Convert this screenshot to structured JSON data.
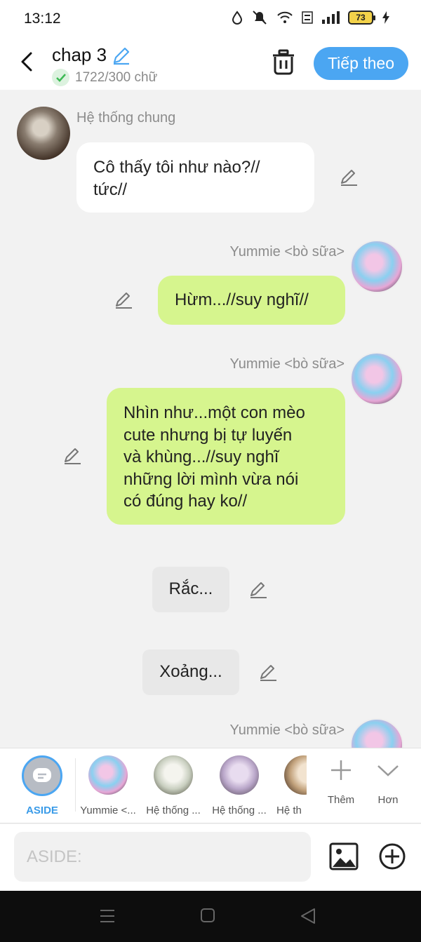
{
  "status": {
    "time": "13:12",
    "battery": "73"
  },
  "header": {
    "title": "chap 3",
    "wordcount": "1722/300 chữ",
    "next_label": "Tiếp theo"
  },
  "messages": [
    {
      "sender": "Hệ thống chung",
      "line1": "Cô thấy tôi như nào?//",
      "line2": "tức//"
    },
    {
      "sender": "Yummie <bò sữa>",
      "text": "Hừm...//suy nghĩ//"
    },
    {
      "sender": "Yummie <bò sữa>",
      "lines": [
        "Nhìn như...một con mèo",
        "cute nhưng bị tự luyến",
        "và khùng...//suy nghĩ",
        "những lời mình vừa nói",
        "có đúng hay ko//"
      ]
    },
    {
      "text": "Rắc..."
    },
    {
      "text": "Xoảng..."
    },
    {
      "sender": "Yummie <bò sữa>"
    }
  ],
  "characters": {
    "aside_label": "ASIDE",
    "items": [
      "Yummie <...",
      "Hệ thống ...",
      "Hệ thống ...",
      "Hệ th"
    ],
    "more_label": "Thêm",
    "collapse_label": "Hơn"
  },
  "input": {
    "placeholder": "ASIDE:"
  },
  "colors": {
    "accent": "#4ba6f2",
    "my_bubble": "#d6f58e",
    "other_bubble": "#ffffff",
    "narration_bubble": "#e8e8e8"
  }
}
